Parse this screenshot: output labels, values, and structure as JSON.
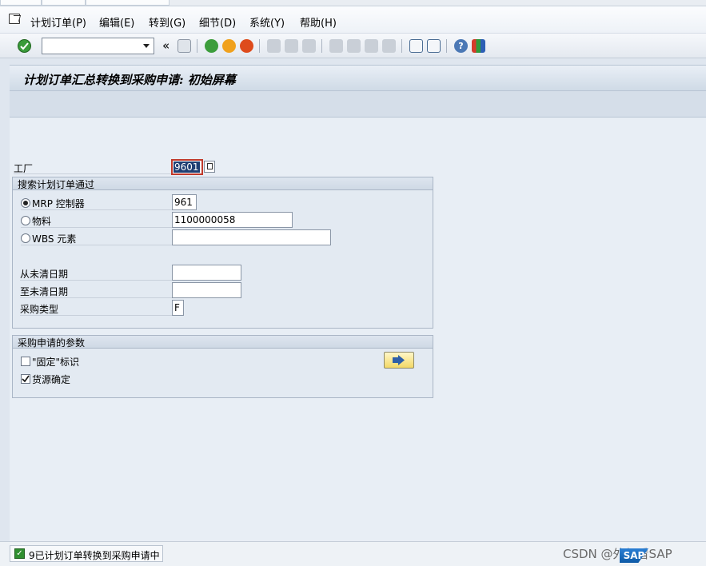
{
  "menubar": {
    "items": [
      "计划订单(P)",
      "编辑(E)",
      "转到(G)",
      "细节(D)",
      "系统(Y)",
      "帮助(H)"
    ]
  },
  "toolbar": {
    "command_value": "",
    "back_glyph": "«",
    "icons": [
      "enter-icon",
      "save-icon",
      "back-icon",
      "exit-icon",
      "cancel-icon",
      "print-icon",
      "find-icon",
      "find-next-icon",
      "first-page-icon",
      "previous-page-icon",
      "next-page-icon",
      "last-page-icon",
      "create-session-icon",
      "shortcut-icon",
      "help-icon",
      "customize-layout-icon"
    ]
  },
  "screen": {
    "title": "计划订单汇总转换到采购申请: 初始屏幕"
  },
  "plant": {
    "label": "工厂",
    "value": "9601"
  },
  "search_group": {
    "title": "搜索计划订单通过",
    "options": [
      {
        "label": "MRP 控制器",
        "value": "961",
        "selected": true
      },
      {
        "label": "物料",
        "value": "1100000058",
        "selected": false
      },
      {
        "label": "WBS 元素",
        "value": "",
        "selected": false
      }
    ],
    "from_date_label": "从未清日期",
    "from_date_value": "",
    "to_date_label": "至未清日期",
    "to_date_value": "",
    "purchase_type_label": "采购类型",
    "purchase_type_value": "F"
  },
  "params_group": {
    "title": "采购申请的参数",
    "fixed_label": "\"固定\"标识",
    "fixed_checked": false,
    "source_label": "货源确定",
    "source_checked": true
  },
  "status": {
    "message": "9已计划订单转换到采购申请中"
  },
  "watermark": {
    "text": "CSDN @外行看SAP",
    "logo": "SAP"
  },
  "colors": {
    "accent_green": "#2f8f2f",
    "selection_blue": "#1f3f73",
    "required_red": "#c0392b"
  }
}
